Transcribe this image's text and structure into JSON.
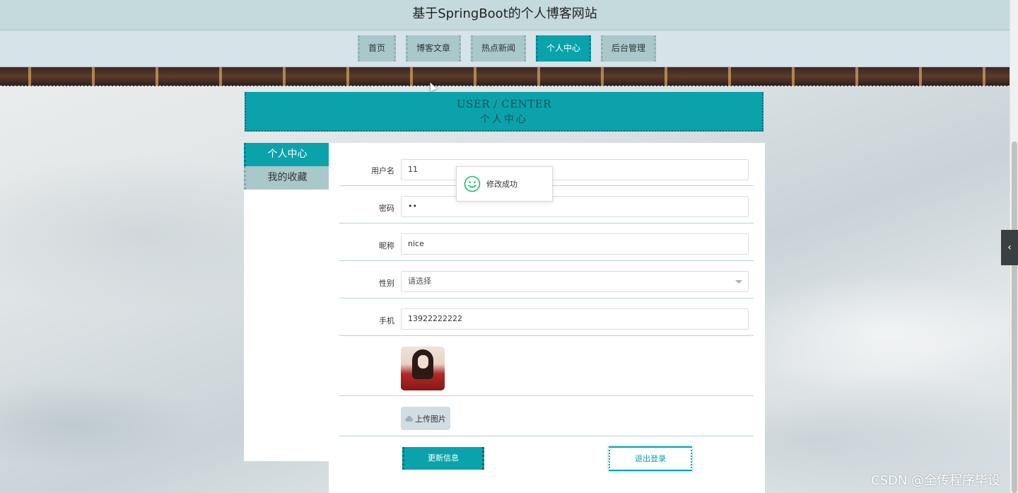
{
  "app": {
    "title": "基于SpringBoot的个人博客网站"
  },
  "nav": {
    "items": [
      {
        "label": "首页",
        "active": false
      },
      {
        "label": "博客文章",
        "active": false
      },
      {
        "label": "热点新闻",
        "active": false
      },
      {
        "label": "个人中心",
        "active": true
      },
      {
        "label": "后台管理",
        "active": false
      }
    ]
  },
  "section": {
    "title_en": "USER / CENTER",
    "title_cn": "个人中心"
  },
  "sidebar": {
    "items": [
      {
        "label": "个人中心",
        "active": true
      },
      {
        "label": "我的收藏",
        "active": false
      }
    ]
  },
  "form": {
    "username": {
      "label": "用户名",
      "value": "11"
    },
    "password": {
      "label": "密码",
      "value": "••"
    },
    "nickname": {
      "label": "昵称",
      "value": "nice"
    },
    "gender": {
      "label": "性别",
      "value": "请选择"
    },
    "phone": {
      "label": "手机",
      "value": "13922222222"
    },
    "upload_label": "上传图片",
    "update_label": "更新信息",
    "logout_label": "退出登录"
  },
  "toast": {
    "message": "修改成功",
    "icon": "smile-icon"
  },
  "side_tab": {
    "icon": "chevron-left-icon",
    "glyph": "‹"
  },
  "watermark": "CSDN @全传程序毕设",
  "colors": {
    "accent": "#0aa3ac",
    "nav_inactive": "#a9c8ca",
    "header_bg": "#c5dadd",
    "toast_icon": "#19be6b"
  }
}
